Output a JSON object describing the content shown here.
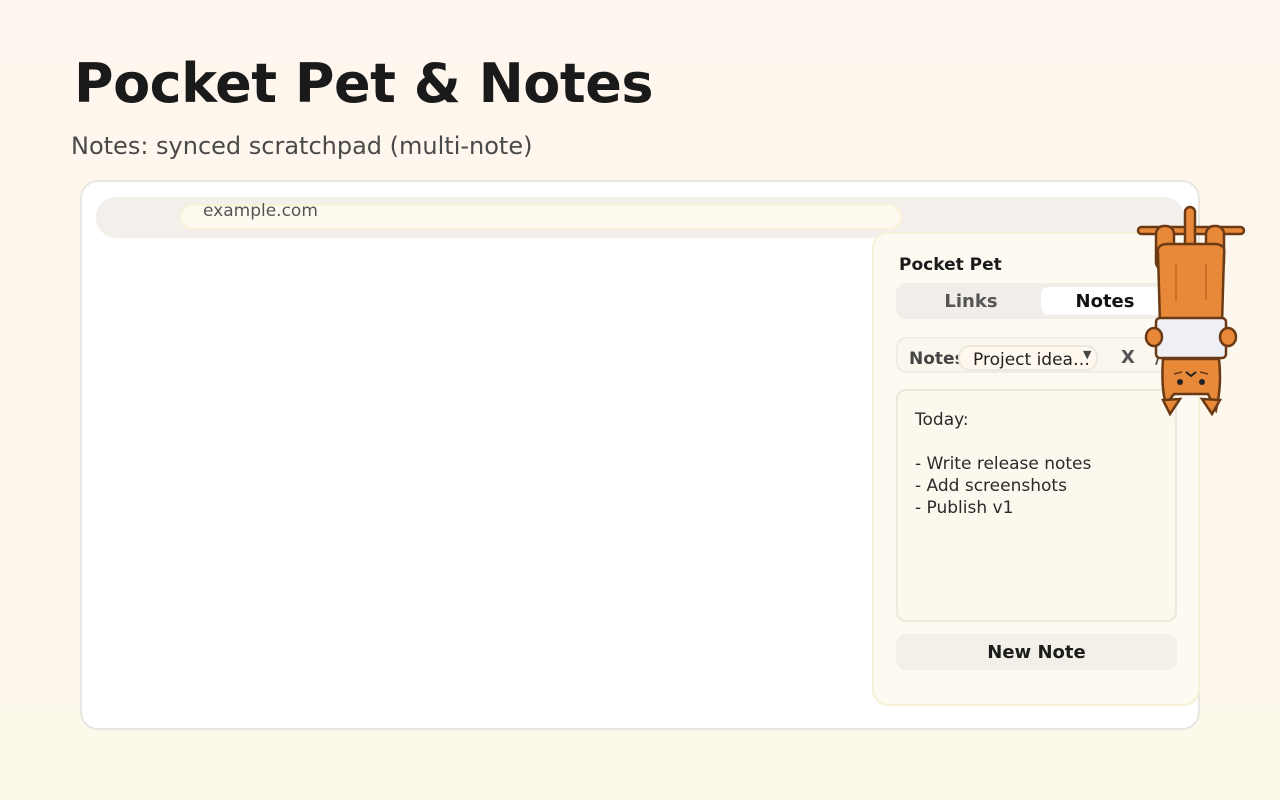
{
  "header": {
    "title": "Pocket Pet & Notes",
    "subtitle": "Notes: synced scratchpad (multi-note)"
  },
  "browser": {
    "address": "example.com"
  },
  "popup": {
    "title": "Pocket Pet",
    "tabs": [
      {
        "label": "Links",
        "active": false
      },
      {
        "label": "Notes",
        "active": true
      }
    ],
    "notes_label": "Notes",
    "selected_note": "Project ideas...",
    "delete_label": "X",
    "rename_label": "/",
    "note_content": "Today:\n\n- Write release notes\n- Add screenshots\n- Publish v1",
    "new_note_label": "New Note"
  },
  "colors": {
    "pet_fur": "#e8893a",
    "pet_outline": "#6b3a14",
    "accent_border": "#f7f1d7"
  },
  "icons": {
    "select_chevron": "chevron-down-icon",
    "pet": "hanging-cat-mascot"
  }
}
